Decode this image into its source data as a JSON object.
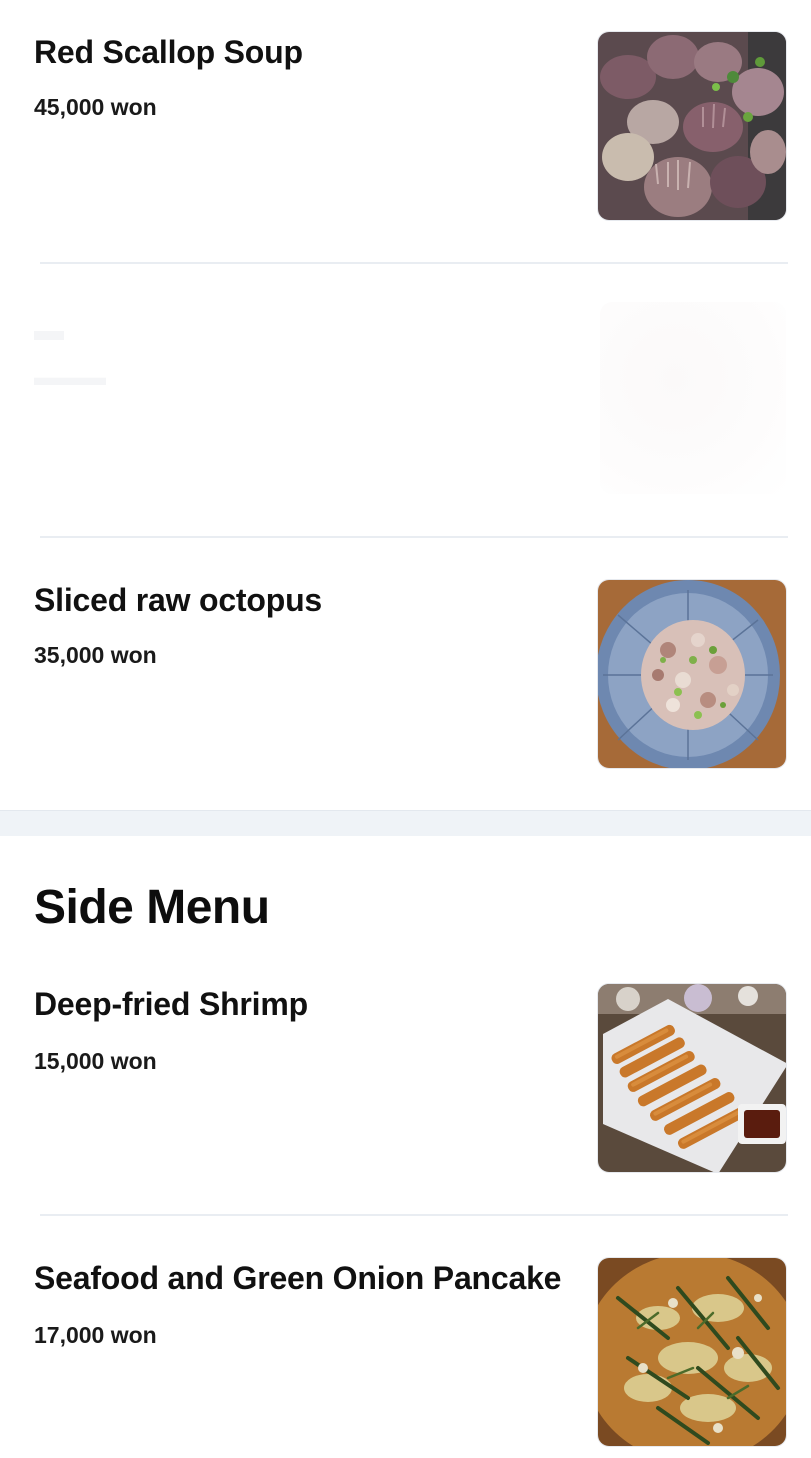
{
  "menu": {
    "items_top": [
      {
        "name": "Red Scallop Soup",
        "price": "45,000 won",
        "image_icon": "scallop-photo"
      },
      {
        "name": "Sliced raw octopus",
        "price": "35,000 won",
        "image_icon": "octopus-photo"
      }
    ],
    "side_section": {
      "title": "Side Menu",
      "items": [
        {
          "name": "Deep-fried Shrimp",
          "price": "15,000 won",
          "image_icon": "fried-shrimp-photo"
        },
        {
          "name": "Seafood and Green Onion Pancake",
          "price": "17,000 won",
          "image_icon": "pancake-photo"
        }
      ]
    }
  },
  "colors": {
    "divider": "#e9edf2",
    "section_gap": "#eff3f7",
    "text": "#111111"
  }
}
